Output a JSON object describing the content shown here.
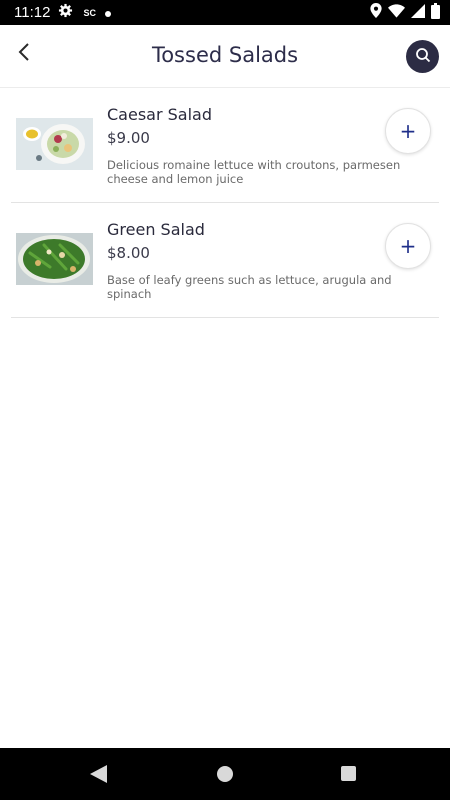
{
  "status_bar": {
    "time": "11:12",
    "sc_label": "SC",
    "icons": [
      "gear-icon",
      "location-icon",
      "wifi-icon",
      "cell-signal-icon",
      "battery-icon"
    ]
  },
  "header": {
    "title": "Tossed Salads",
    "back_icon": "chevron-left-icon",
    "search_icon": "search-icon"
  },
  "items": [
    {
      "name": "Caesar Salad",
      "price": "$9.00",
      "description": "Delicious romaine lettuce with croutons, parmesen cheese and lemon juice",
      "add_label": "+"
    },
    {
      "name": "Green Salad",
      "price": "$8.00",
      "description": "Base of leafy greens such as lettuce, arugula and spinach",
      "add_label": "+"
    }
  ],
  "nav_bar": {
    "icons": [
      "nav-back-icon",
      "nav-home-icon",
      "nav-recents-icon"
    ]
  },
  "colors": {
    "title": "#2d2d4a",
    "search_button_bg": "#2c2c44",
    "add_icon": "#1f2f8a"
  }
}
